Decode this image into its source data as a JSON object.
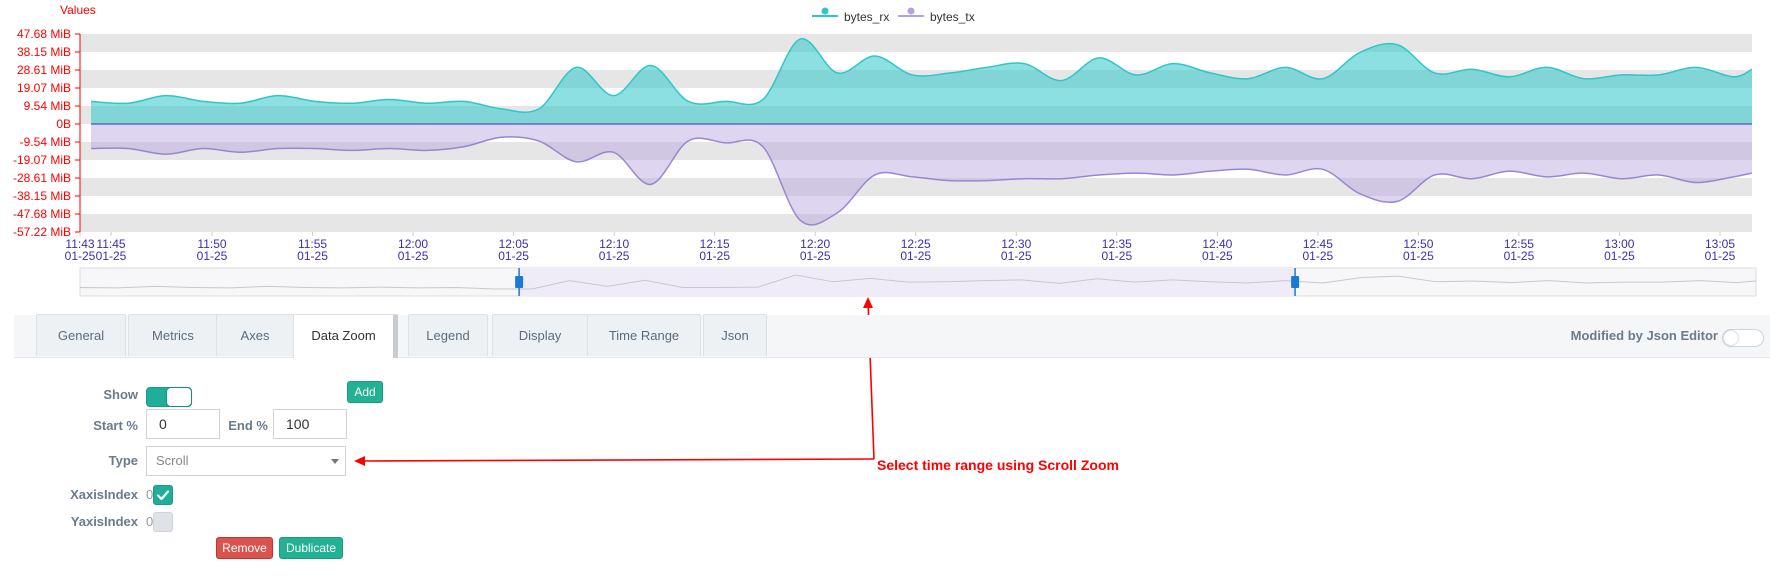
{
  "chart": {
    "legend": [
      {
        "name": "bytes_rx",
        "color": "#2ec7c9"
      },
      {
        "name": "bytes_tx",
        "color": "#b6a2de"
      }
    ],
    "y_axis_name": "Values",
    "y_ticks": [
      "47.68 MiB",
      "38.15 MiB",
      "28.61 MiB",
      "19.07 MiB",
      "9.54 MiB",
      "0B",
      "-9.54 MiB",
      "-19.07 MiB",
      "-28.61 MiB",
      "-38.15 MiB",
      "-47.68 MiB",
      "-57.22 MiB"
    ],
    "x_ticks": [
      {
        "time": "11:43",
        "date": "01-25"
      },
      {
        "time": "11:45",
        "date": "01-25"
      },
      {
        "time": "11:50",
        "date": "01-25"
      },
      {
        "time": "11:55",
        "date": "01-25"
      },
      {
        "time": "12:00",
        "date": "01-25"
      },
      {
        "time": "12:05",
        "date": "01-25"
      },
      {
        "time": "12:10",
        "date": "01-25"
      },
      {
        "time": "12:15",
        "date": "01-25"
      },
      {
        "time": "12:20",
        "date": "01-25"
      },
      {
        "time": "12:25",
        "date": "01-25"
      },
      {
        "time": "12:30",
        "date": "01-25"
      },
      {
        "time": "12:35",
        "date": "01-25"
      },
      {
        "time": "12:40",
        "date": "01-25"
      },
      {
        "time": "12:45",
        "date": "01-25"
      },
      {
        "time": "12:50",
        "date": "01-25"
      },
      {
        "time": "12:55",
        "date": "01-25"
      },
      {
        "time": "13:00",
        "date": "01-25"
      },
      {
        "time": "13:05",
        "date": "01-25"
      }
    ],
    "colors": {
      "axis_labels": "#ff0000",
      "x_labels": "#3a2fb0",
      "band": "#e6e6e6",
      "rx": "#2ec7c9",
      "tx": "#b6a2de",
      "zoom_fill": "#efecf8",
      "handle": "#1a7bd6"
    },
    "zoom": {
      "start_pct": 26.2,
      "end_pct": 72.5
    }
  },
  "chart_data": {
    "type": "area",
    "xlabel": "",
    "ylabel": "Values",
    "ylim_mib": [
      -57.22,
      47.68
    ],
    "x_minutes_from_1143": [
      0,
      2,
      4,
      6,
      8,
      10,
      12,
      14,
      16,
      18,
      20,
      22,
      24,
      26,
      28,
      30,
      32,
      34,
      36,
      38,
      40,
      42,
      44,
      46,
      48,
      50,
      52,
      54,
      56,
      58,
      60,
      62,
      64,
      66,
      68,
      70,
      72,
      74,
      76,
      78,
      80,
      82,
      84,
      86,
      88,
      89
    ],
    "series": [
      {
        "name": "bytes_rx",
        "unit": "MiB",
        "values": [
          12,
          11,
          15,
          12,
          11,
          15,
          12,
          11,
          13,
          11,
          12,
          8,
          8,
          30,
          15,
          31,
          12,
          12,
          13,
          45,
          27,
          36,
          26,
          27,
          30,
          32,
          23,
          35,
          26,
          32,
          27,
          24,
          30,
          24,
          38,
          42,
          27,
          29,
          25,
          30,
          24,
          26,
          26,
          30,
          25,
          29
        ]
      },
      {
        "name": "bytes_tx",
        "unit": "MiB",
        "values": [
          -13,
          -13,
          -16,
          -13,
          -15,
          -13,
          -13,
          -14,
          -13,
          -14,
          -12,
          -7,
          -9,
          -20,
          -15,
          -32,
          -9,
          -10,
          -12,
          -51,
          -47,
          -27,
          -28,
          -30,
          -30,
          -29,
          -29,
          -27,
          -26,
          -27,
          -25,
          -24,
          -27,
          -24,
          -37,
          -41,
          -27,
          -29,
          -25,
          -28,
          -26,
          -29,
          -27,
          -31,
          -28,
          -26
        ]
      }
    ]
  },
  "tabs": [
    "General",
    "Metrics",
    "Axes",
    "Data Zoom",
    "Legend",
    "Display",
    "Time Range",
    "Json"
  ],
  "active_tab": "Data Zoom",
  "modified_label": "Modified by Json Editor",
  "form": {
    "show_label": "Show",
    "add_label": "Add",
    "start_label": "Start %",
    "start_value": "0",
    "end_label": "End %",
    "end_value": "100",
    "type_label": "Type",
    "type_value": "Scroll",
    "xaxis_label": "XaxisIndex",
    "xaxis_value": "0",
    "yaxis_label": "YaxisIndex",
    "yaxis_value": "0",
    "remove_label": "Remove",
    "duplicate_label": "Dublicate"
  },
  "annotation": "Select time range using Scroll Zoom"
}
